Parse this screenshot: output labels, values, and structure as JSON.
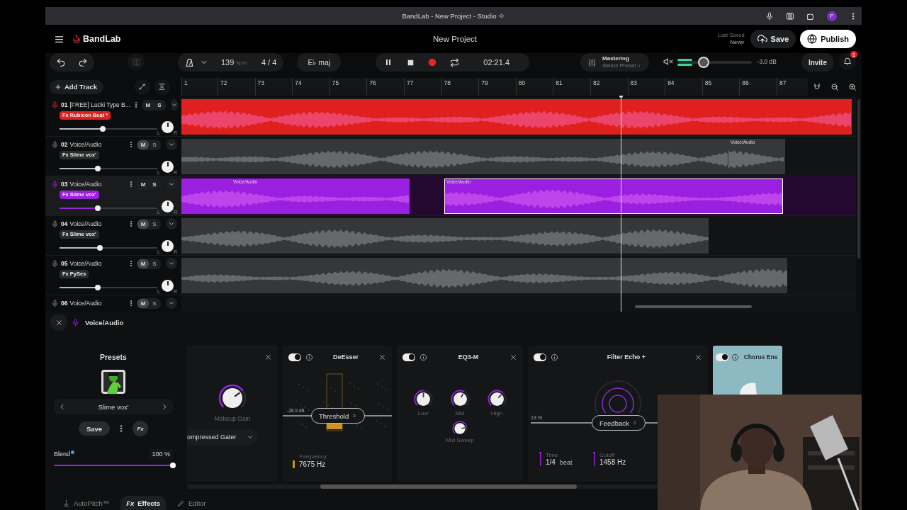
{
  "browser_bar": {
    "title": "BandLab - New Project - Studio",
    "avatar": "F"
  },
  "header": {
    "logo": "BandLab",
    "project_title": "New Project",
    "last_saved_label": "Last Saved",
    "last_saved_value": "Never",
    "save": "Save",
    "publish": "Publish"
  },
  "transport": {
    "tempo": "139",
    "tempo_unit": "bpm",
    "time_signature": "4 / 4",
    "key": "E♭ maj",
    "playing": true,
    "time": "02:21.4",
    "mastering": "Mastering",
    "mastering_preset": "Select Preset",
    "meter": {
      "level": 0.2
    },
    "volume": {
      "level": 0.36
    },
    "volume_reading": "-3.0 dB",
    "invite": "Invite",
    "notifications": "1"
  },
  "timeline": {
    "add_track": "Add Track",
    "ruler": [
      "1",
      "72",
      "73",
      "74",
      "75",
      "76",
      "77",
      "78",
      "79",
      "80",
      "81",
      "82",
      "83",
      "84",
      "85",
      "86",
      "87"
    ]
  },
  "tracks": [
    {
      "number": "01",
      "name": "[FREE] Lucki Type B...",
      "effect": "Fx Rubicon Beat *",
      "color": "#e0201e",
      "selected": false,
      "muted": false,
      "soloed": false,
      "mute_label": "M",
      "solo_label": "S",
      "level": 0.44,
      "pan_left": "L",
      "pan_right": "R",
      "clips": [
        {
          "selected": false
        }
      ]
    },
    {
      "number": "02",
      "name": "Voice/Audio",
      "effect": "Fx Slime vox'",
      "selected": false,
      "muted": true,
      "soloed": false,
      "mute_label": "M",
      "solo_label": "S",
      "level": 0.39,
      "pan_left": "L",
      "pan_right": "R",
      "clips": [
        {
          "selected": false
        },
        {
          "label": "Voice/Audio",
          "selected": false
        }
      ]
    },
    {
      "number": "03",
      "name": "Voice/Audio",
      "effect": "Fx Slime vox'",
      "color": "#9b1fe0",
      "selected": true,
      "muted": false,
      "soloed": false,
      "mute_label": "M",
      "solo_label": "S",
      "level": 0.39,
      "pan_left": "L",
      "pan_right": "R",
      "clips": [
        {
          "label": "Voice/Audio",
          "selected": false
        },
        {
          "label": "Voice/Audio",
          "selected": true
        }
      ]
    },
    {
      "number": "04",
      "name": "Voice/Audio",
      "effect": "Fx Slime vox'",
      "selected": false,
      "muted": true,
      "soloed": false,
      "mute_label": "M",
      "solo_label": "S",
      "level": 0.41,
      "pan_left": "L",
      "pan_right": "R",
      "clips": [
        {
          "selected": false
        }
      ]
    },
    {
      "number": "05",
      "name": "Voice/Audio",
      "effect": "Fx PySes",
      "selected": false,
      "muted": true,
      "soloed": false,
      "mute_label": "M",
      "solo_label": "S",
      "level": 0.39,
      "pan_left": "L",
      "pan_right": "R",
      "clips": [
        {
          "selected": false
        }
      ]
    },
    {
      "number": "06",
      "name": "Voice/Audio",
      "selected": false,
      "muted": true,
      "soloed": false,
      "mute_label": "M",
      "solo_label": "S"
    }
  ],
  "effects_panel": {
    "track_name": "Voice/Audio",
    "presets": {
      "title": "Presets",
      "preset_name": "Slime vox'",
      "save": "Save",
      "fx_button": "Fx",
      "blend_label": "Blend",
      "blend_reading": "100 %",
      "blend": {
        "level": 1
      }
    },
    "effects": [
      {
        "kind": "compressor",
        "knob_label": "Makeup Gain",
        "mode": "ompressed Gater"
      },
      {
        "kind": "deesser",
        "title": "DeEsser",
        "enabled": true,
        "threshold_reading": "-28.9 dB",
        "threshold": "Threshold",
        "param_label": "Frequency",
        "param_value": "7675 Hz"
      },
      {
        "kind": "eq",
        "title": "EQ3-M",
        "enabled": true,
        "knobs": [
          {
            "label": "Low"
          },
          {
            "label": "Mid"
          },
          {
            "label": "High"
          },
          {
            "label": "Mid Sweep"
          }
        ]
      },
      {
        "kind": "echo",
        "title": "Filter Echo +",
        "enabled": true,
        "mix_reading": "13 %",
        "feedback": "Feedback",
        "params": [
          {
            "label": "Time",
            "value": "1/4",
            "unit": "beat"
          },
          {
            "label": "Cutoff",
            "value": "1458 Hz"
          }
        ]
      },
      {
        "kind": "chorus",
        "title": "Chorus Ens",
        "enabled": true
      }
    ]
  },
  "bottom_tabs": [
    {
      "label": "AutoPitch™",
      "selected": false
    },
    {
      "icon": "Fx",
      "label": "Effects",
      "selected": true
    },
    {
      "label": "Editor",
      "selected": false
    }
  ]
}
